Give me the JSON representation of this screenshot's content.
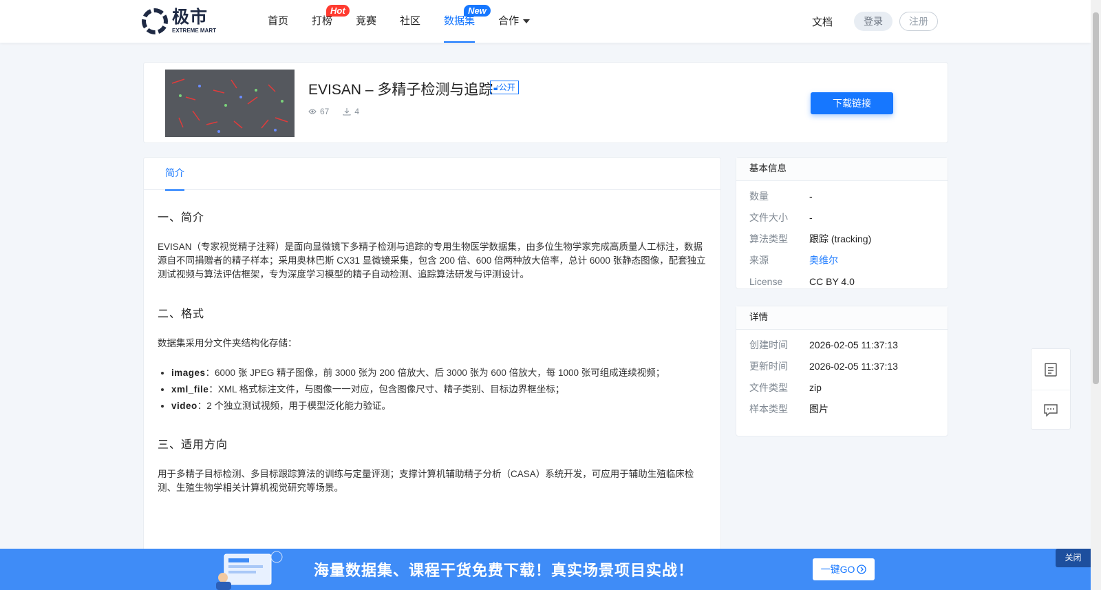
{
  "header": {
    "logo_cn": "极市",
    "logo_en": "EXTREME MART",
    "nav": [
      {
        "label": "首页"
      },
      {
        "label": "打榜",
        "badge": "Hot"
      },
      {
        "label": "竞赛"
      },
      {
        "label": "社区"
      },
      {
        "label": "数据集",
        "badge": "New",
        "active": true
      },
      {
        "label": "合作"
      }
    ],
    "docs": "文档",
    "login": "登录",
    "register": "注册"
  },
  "dataset": {
    "title": "EVISAN – 多精子检测与追踪",
    "visibility": "公开",
    "views": "67",
    "downloads": "4",
    "download_button": "下载链接"
  },
  "tabs": [
    "简介"
  ],
  "content": {
    "h1": "一、简介",
    "p1": "EVISAN（专家视觉精子注释）是面向显微镜下多精子检测与追踪的专用生物医学数据集，由多位生物学家完成高质量人工标注，数据源自不同捐赠者的精子样本；采用奥林巴斯 CX31 显微镜采集，包含 200 倍、600 倍两种放大倍率，总计 6000 张静态图像，配套独立测试视频与算法评估框架，专为深度学习模型的精子自动检测、追踪算法研发与评测设计。",
    "h2": "二、格式",
    "p2": "数据集采用分文件夹结构化存储：",
    "list": [
      {
        "term": "images",
        "desc": "：6000 张 JPEG 精子图像，前 3000 张为 200 倍放大、后 3000 张为 600 倍放大，每 1000 张可组成连续视频；"
      },
      {
        "term": "xml_file",
        "desc": "：XML 格式标注文件，与图像一一对应，包含图像尺寸、精子类别、目标边界框坐标；"
      },
      {
        "term": "video",
        "desc": "：2 个独立测试视频，用于模型泛化能力验证。"
      }
    ],
    "h3": "三、适用方向",
    "p3": "用于多精子目标检测、多目标跟踪算法的训练与定量评测；支撑计算机辅助精子分析（CASA）系统开发，可应用于辅助生殖临床检测、生殖生物学相关计算机视觉研究等场景。"
  },
  "basic_info": {
    "title": "基本信息",
    "rows": [
      {
        "k": "数量",
        "v": "-"
      },
      {
        "k": "文件大小",
        "v": "-"
      },
      {
        "k": "算法类型",
        "v": "跟踪 (tracking)"
      },
      {
        "k": "来源",
        "v": "奥维尔"
      },
      {
        "k": "License",
        "v": "CC BY 4.0"
      }
    ]
  },
  "details": {
    "title": "详情",
    "rows": [
      {
        "k": "创建时间",
        "v": "2026-02-05 11:37:13"
      },
      {
        "k": "更新时间",
        "v": "2026-02-05 11:37:13"
      },
      {
        "k": "文件类型",
        "v": "zip"
      },
      {
        "k": "样本类型",
        "v": "图片"
      }
    ]
  },
  "banner": {
    "text": "海量数据集、课程干货免费下载！真实场景项目实战！",
    "go": "一键GO",
    "close": "关闭"
  },
  "colors": {
    "accent": "#1677ff",
    "hot": "#ff3b30",
    "banner": "#3f8cf7"
  }
}
